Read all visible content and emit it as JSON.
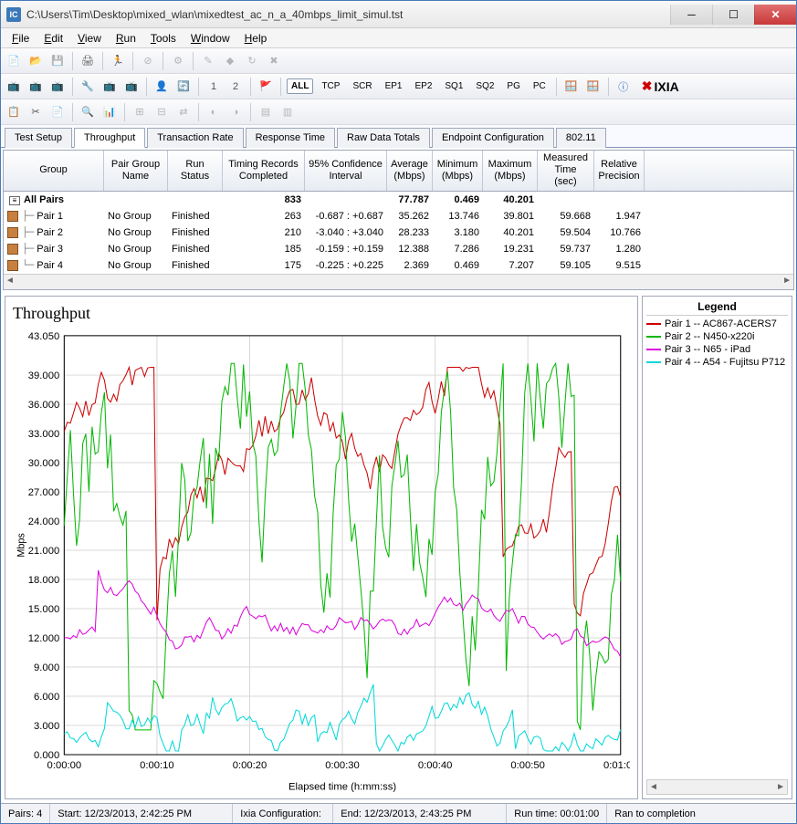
{
  "window": {
    "title": "C:\\Users\\Tim\\Desktop\\mixed_wlan\\mixedtest_ac_n_a_40mbps_limit_simul.tst"
  },
  "menu": [
    "File",
    "Edit",
    "View",
    "Run",
    "Tools",
    "Window",
    "Help"
  ],
  "toolbar2": {
    "labels": [
      "ALL",
      "TCP",
      "SCR",
      "EP1",
      "EP2",
      "SQ1",
      "SQ2",
      "PG",
      "PC"
    ],
    "brand": "IXIA"
  },
  "tabs": [
    "Test Setup",
    "Throughput",
    "Transaction Rate",
    "Response Time",
    "Raw Data Totals",
    "Endpoint Configuration",
    "802.11"
  ],
  "active_tab": 1,
  "table": {
    "headers": [
      "Group",
      "Pair Group Name",
      "Run Status",
      "Timing Records Completed",
      "95% Confidence Interval",
      "Average (Mbps)",
      "Minimum (Mbps)",
      "Maximum (Mbps)",
      "Measured Time (sec)",
      "Relative Precision"
    ],
    "total_row": {
      "group": "All Pairs",
      "timing": "833",
      "avg": "77.787",
      "min": "0.469",
      "max": "40.201"
    },
    "rows": [
      {
        "group": "Pair 1",
        "pgn": "No Group",
        "run": "Finished",
        "timing": "263",
        "conf": "-0.687 : +0.687",
        "avg": "35.262",
        "min": "13.746",
        "max": "39.801",
        "meas": "59.668",
        "rel": "1.947"
      },
      {
        "group": "Pair 2",
        "pgn": "No Group",
        "run": "Finished",
        "timing": "210",
        "conf": "-3.040 : +3.040",
        "avg": "28.233",
        "min": "3.180",
        "max": "40.201",
        "meas": "59.504",
        "rel": "10.766"
      },
      {
        "group": "Pair 3",
        "pgn": "No Group",
        "run": "Finished",
        "timing": "185",
        "conf": "-0.159 : +0.159",
        "avg": "12.388",
        "min": "7.286",
        "max": "19.231",
        "meas": "59.737",
        "rel": "1.280"
      },
      {
        "group": "Pair 4",
        "pgn": "No Group",
        "run": "Finished",
        "timing": "175",
        "conf": "-0.225 : +0.225",
        "avg": "2.369",
        "min": "0.469",
        "max": "7.207",
        "meas": "59.105",
        "rel": "9.515"
      }
    ]
  },
  "chart_data": {
    "type": "line",
    "title": "Throughput",
    "xlabel": "Elapsed time (h:mm:ss)",
    "ylabel": "Mbps",
    "ylim": [
      0,
      43.05
    ],
    "yticks": [
      0,
      3,
      6,
      9,
      12,
      15,
      18,
      21,
      24,
      27,
      30,
      33,
      36,
      39,
      43.05
    ],
    "ytick_labels": [
      "0.000",
      "3.000",
      "6.000",
      "9.000",
      "12.000",
      "15.000",
      "18.000",
      "21.000",
      "24.000",
      "27.000",
      "30.000",
      "33.000",
      "36.000",
      "39.000",
      "43.050"
    ],
    "xticks": [
      0,
      10,
      20,
      30,
      40,
      50,
      60
    ],
    "xtick_labels": [
      "0:00:00",
      "0:00:10",
      "0:00:20",
      "0:00:30",
      "0:00:40",
      "0:00:50",
      "0:01:00"
    ],
    "series": [
      {
        "name": "Pair 1 -- AC867-ACERS7",
        "color": "#cc0000",
        "avg": 35.262,
        "min": 13.746,
        "max": 39.801,
        "volatility": 2.2
      },
      {
        "name": "Pair 2 -- N450-x220i",
        "color": "#00b800",
        "avg": 28.233,
        "min": 3.18,
        "max": 40.201,
        "volatility": 8.5
      },
      {
        "name": "Pair 3 -- N65 - iPad",
        "color": "#dd00dd",
        "avg": 12.388,
        "min": 7.286,
        "max": 19.231,
        "volatility": 0.9
      },
      {
        "name": "Pair 4 -- A54 - Fujitsu P712",
        "color": "#00d8d8",
        "avg": 2.369,
        "min": 0.469,
        "max": 7.207,
        "volatility": 1.3
      }
    ]
  },
  "legend": {
    "title": "Legend"
  },
  "status": {
    "pairs": "Pairs: 4",
    "start": "Start: 12/23/2013, 2:42:25 PM",
    "config": "Ixia Configuration:",
    "end": "End: 12/23/2013, 2:43:25 PM",
    "runtime": "Run time: 00:01:00",
    "ran": "Ran to completion"
  }
}
